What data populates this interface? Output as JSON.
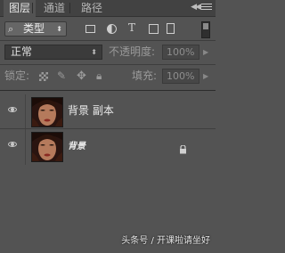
{
  "tabs": [
    {
      "label": "图层",
      "active": true
    },
    {
      "label": "通道",
      "active": false
    },
    {
      "label": "路径",
      "active": false
    }
  ],
  "filter": {
    "type_label": "类型",
    "search_icon": "search-icon",
    "icons": [
      "pixel-filter-icon",
      "adjustment-filter-icon",
      "type-filter-icon",
      "shape-filter-icon",
      "smart-object-filter-icon"
    ]
  },
  "blend": {
    "mode": "正常",
    "opacity_label": "不透明度:",
    "opacity_value": "100%"
  },
  "lock": {
    "label": "锁定:",
    "fill_label": "填充:",
    "fill_value": "100%"
  },
  "layers": [
    {
      "name": "背景 副本",
      "visible": true,
      "locked": false
    },
    {
      "name": "背景",
      "visible": true,
      "locked": true
    }
  ],
  "watermark": "头条号 / 开课啦请坐好",
  "colors": {
    "panel_bg": "#535353",
    "tab_bar_bg": "#424242",
    "text": "#eaeaea",
    "muted_text": "#9a9a9a"
  }
}
